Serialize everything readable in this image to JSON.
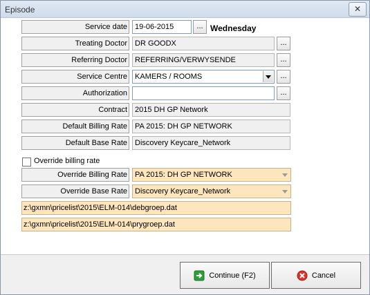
{
  "window": {
    "title": "Episode",
    "close_glyph": "✕"
  },
  "ellipsis": "...",
  "service_date": {
    "label": "Service date",
    "value": "19-06-2015",
    "weekday": "Wednesday"
  },
  "treating_doctor": {
    "label": "Treating Doctor",
    "value": "DR GOODX"
  },
  "referring_doctor": {
    "label": "Referring Doctor",
    "value": "REFERRING/VERWYSENDE"
  },
  "service_centre": {
    "label": "Service Centre",
    "value": "KAMERS / ROOMS"
  },
  "authorization": {
    "label": "Authorization",
    "value": ""
  },
  "contract": {
    "label": "Contract",
    "value": "2015 DH GP Network"
  },
  "default_billing_rate": {
    "label": "Default Billing Rate",
    "value": "PA 2015: DH GP NETWORK"
  },
  "default_base_rate": {
    "label": "Default Base Rate",
    "value": "Discovery Keycare_Network"
  },
  "override_checkbox": {
    "label": "Override billing rate",
    "checked": false
  },
  "override_billing_rate": {
    "label": "Override Billing Rate",
    "value": "PA 2015: DH GP NETWORK"
  },
  "override_base_rate": {
    "label": "Override Base Rate",
    "value": "Discovery Keycare_Network"
  },
  "paths": {
    "debgroep": "z:\\gxmn\\pricelist\\2015\\ELM-014\\debgroep.dat",
    "prygroep": "z:\\gxmn\\pricelist\\2015\\ELM-014\\prygroep.dat"
  },
  "buttons": {
    "continue": "Continue (F2)",
    "cancel": "Cancel"
  },
  "colors": {
    "highlight_field": "#fde5bd",
    "continue_icon": "#2e9e3a",
    "cancel_icon": "#d9342b"
  },
  "icons": {
    "continue": "arrow-right-icon",
    "cancel": "cancel-x-icon"
  }
}
